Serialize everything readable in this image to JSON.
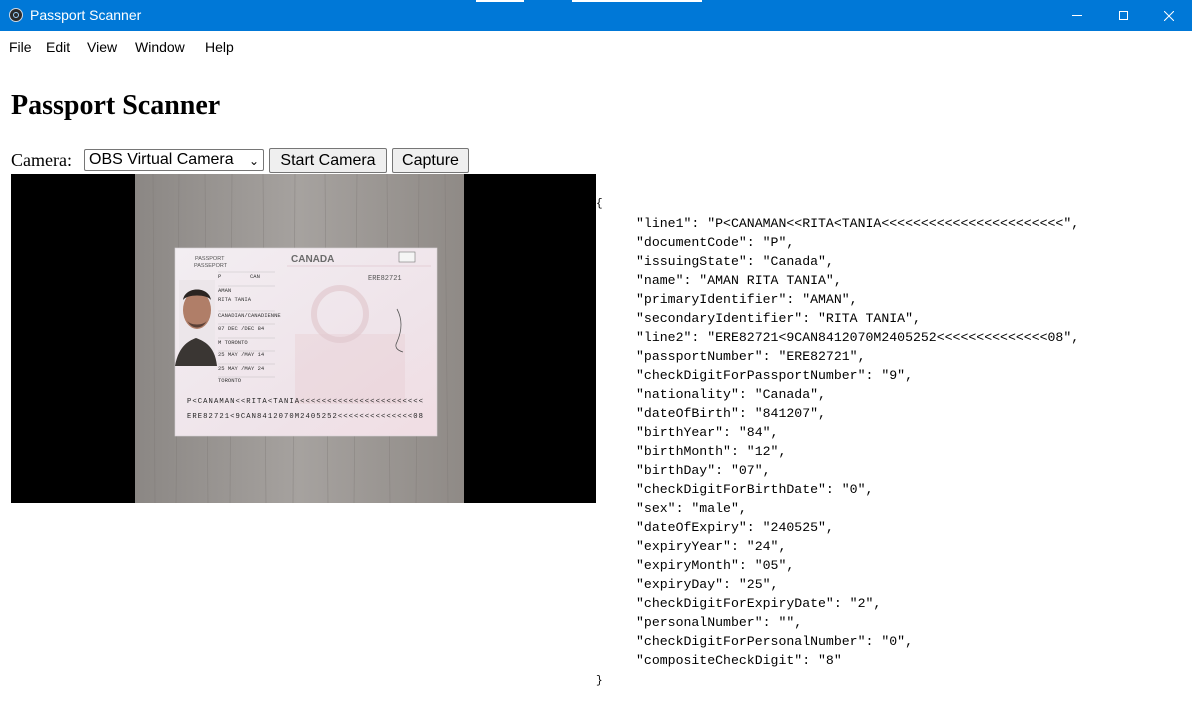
{
  "window": {
    "title": "Passport Scanner"
  },
  "menu": [
    "File",
    "Edit",
    "View",
    "Window",
    "Help"
  ],
  "page": {
    "heading": "Passport Scanner",
    "camera_label": "Camera:",
    "camera_selected": "OBS Virtual Camera",
    "start_camera_label": "Start Camera",
    "capture_label": "Capture"
  },
  "passport_image": {
    "header_left_1": "PASSPORT",
    "header_left_2": "PASSEPORT",
    "country": "CANADA",
    "type": "P",
    "issuing_country": "CAN",
    "passport_no": "ERE82721",
    "surname": "AMAN",
    "given_names": "RITA TANIA",
    "nationality": "CANADIAN/CANADIENNE",
    "dob": "07 DEC /DEC 84",
    "sex_place": "M    TORONTO",
    "issue_date": "25 MAY /MAY 14",
    "expiry_date": "25 MAY /MAY 24",
    "authority": "TORONTO",
    "mrz1": "P<CANAMAN<<RITA<TANIA<<<<<<<<<<<<<<<<<<<<<<<",
    "mrz2": "ERE82721<9CAN8412070M2405252<<<<<<<<<<<<<<08"
  },
  "icons": {
    "app": "electron-app-icon",
    "minimize": "minimize-icon",
    "maximize": "maximize-icon",
    "close": "close-icon",
    "dropdown": "chevron-down-icon"
  },
  "output": {
    "open_brace": "{",
    "close_brace": "}",
    "lines": [
      "\"line1\": \"P<CANAMAN<<RITA<TANIA<<<<<<<<<<<<<<<<<<<<<<<\",",
      "\"documentCode\": \"P\",",
      "\"issuingState\": \"Canada\",",
      "\"name\": \"AMAN RITA TANIA\",",
      "\"primaryIdentifier\": \"AMAN\",",
      "\"secondaryIdentifier\": \"RITA TANIA\",",
      "\"line2\": \"ERE82721<9CAN8412070M2405252<<<<<<<<<<<<<<08\",",
      "\"passportNumber\": \"ERE82721\",",
      "\"checkDigitForPassportNumber\": \"9\",",
      "\"nationality\": \"Canada\",",
      "\"dateOfBirth\": \"841207\",",
      "\"birthYear\": \"84\",",
      "\"birthMonth\": \"12\",",
      "\"birthDay\": \"07\",",
      "\"checkDigitForBirthDate\": \"0\",",
      "\"sex\": \"male\",",
      "\"dateOfExpiry\": \"240525\",",
      "\"expiryYear\": \"24\",",
      "\"expiryMonth\": \"05\",",
      "\"expiryDay\": \"25\",",
      "\"checkDigitForExpiryDate\": \"2\",",
      "\"personalNumber\": \"\",",
      "\"checkDigitForPersonalNumber\": \"0\",",
      "\"compositeCheckDigit\": \"8\""
    ]
  }
}
